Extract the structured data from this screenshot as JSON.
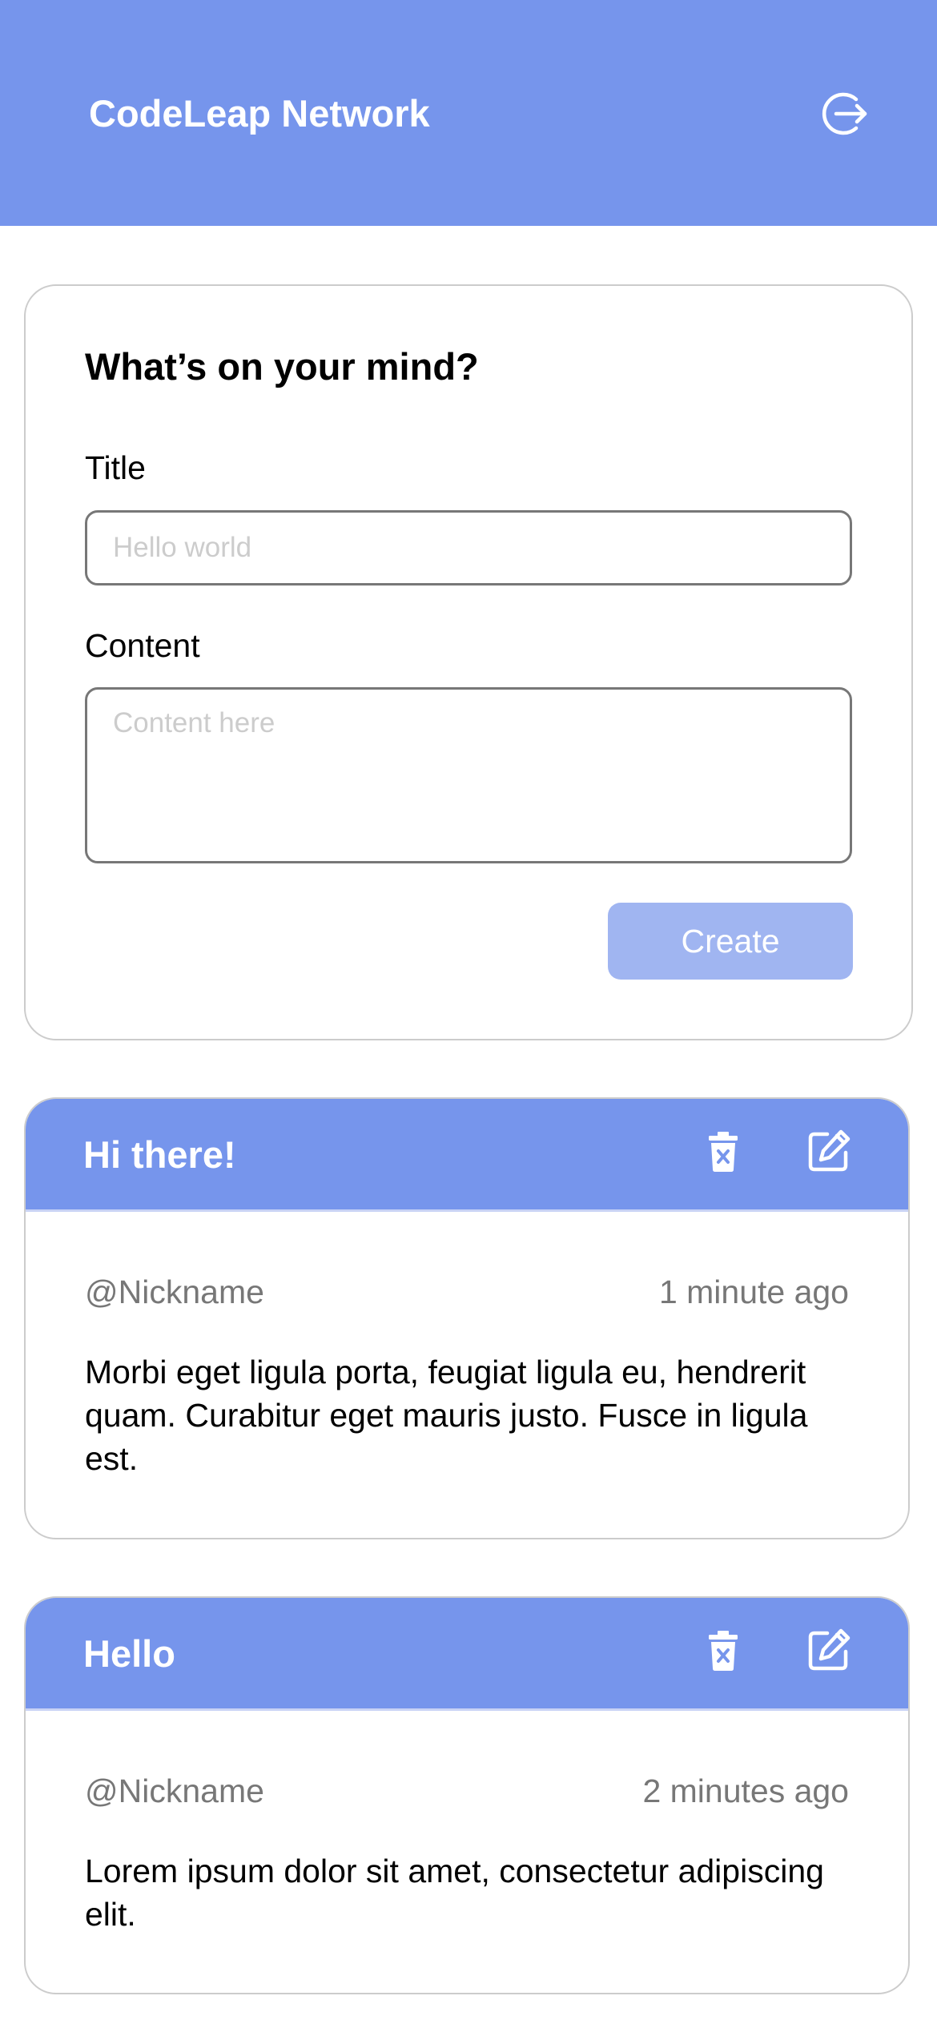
{
  "app": {
    "title": "CodeLeap Network",
    "logout_icon": "logout-icon",
    "brand_color": "#7695EC"
  },
  "create_form": {
    "heading": "What’s on your mind?",
    "title_label": "Title",
    "title_placeholder": "Hello world",
    "title_value": "",
    "content_label": "Content",
    "content_placeholder": "Content here",
    "content_value": "",
    "submit_label": "Create",
    "submit_state": "disabled",
    "submit_color": "#A0B5F1"
  },
  "posts": [
    {
      "title": "Hi there!",
      "author": "@Nickname",
      "time": "1 minute ago",
      "content": "Morbi eget ligula porta, feugiat ligula eu, hendrerit quam. Curabitur eget mauris justo. Fusce in ligula est.",
      "delete_icon": "trash-icon",
      "edit_icon": "edit-icon"
    },
    {
      "title": "Hello",
      "author": "@Nickname",
      "time": "2 minutes ago",
      "content": "Lorem ipsum dolor sit amet, consectetur adipiscing elit.",
      "delete_icon": "trash-icon",
      "edit_icon": "edit-icon"
    }
  ]
}
